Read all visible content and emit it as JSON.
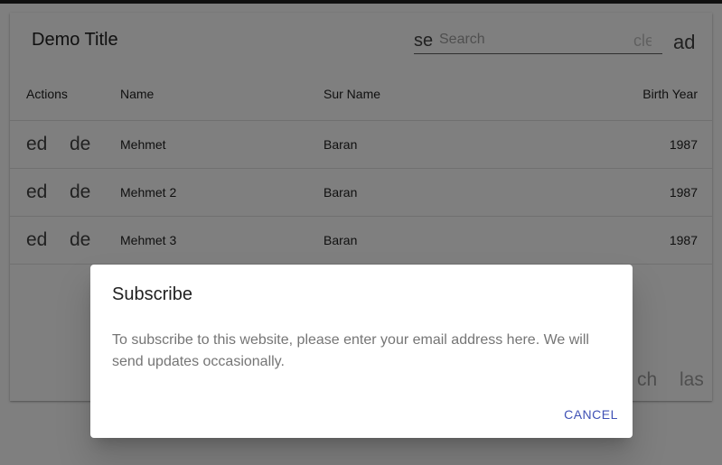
{
  "toolbar": {
    "title": "Demo Title",
    "search_icon": "se",
    "search_placeholder": "Search",
    "clear_icon": "cle",
    "add_icon": "ad"
  },
  "table": {
    "columns": [
      "Actions",
      "Name",
      "Sur Name",
      "Birth Year"
    ],
    "rows": [
      {
        "edit": "ed",
        "delete": "de",
        "name": "Mehmet",
        "surname": "Baran",
        "birth_year": "1987"
      },
      {
        "edit": "ed",
        "delete": "de",
        "name": "Mehmet 2",
        "surname": "Baran",
        "birth_year": "1987"
      },
      {
        "edit": "ed",
        "delete": "de",
        "name": "Mehmet 3",
        "surname": "Baran",
        "birth_year": "1987"
      }
    ]
  },
  "pagination": {
    "first_icon": "ch",
    "last_icon": "las"
  },
  "dialog": {
    "title": "Subscribe",
    "text": "To subscribe to this website, please enter your email address here. We will send updates occasionally.",
    "cancel_label": "Cancel"
  }
}
